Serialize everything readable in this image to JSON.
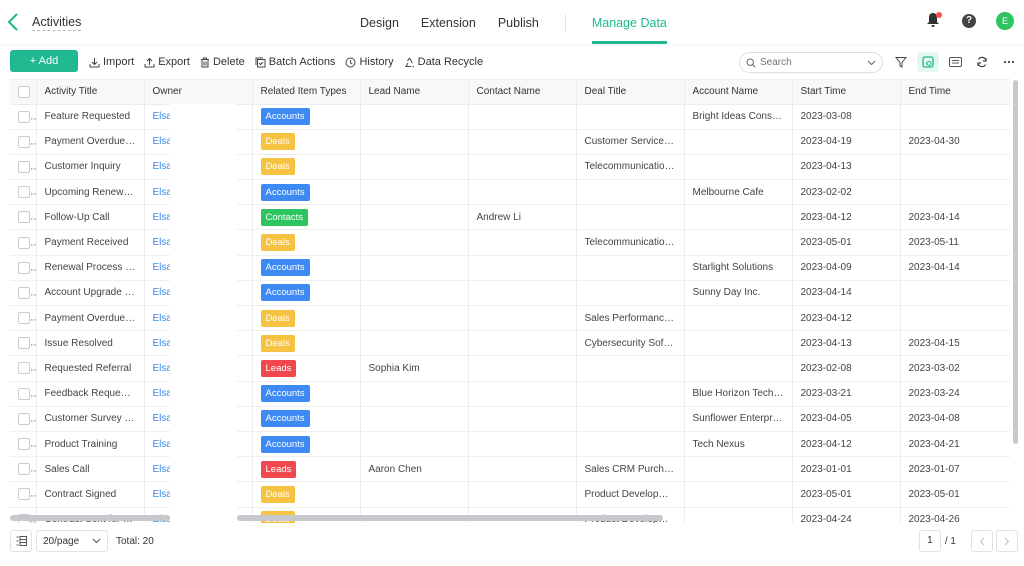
{
  "header": {
    "title": "Activities",
    "nav": [
      "Design",
      "Extension",
      "Publish",
      "Manage Data"
    ],
    "active_nav": "Manage Data",
    "avatar_letter": "E",
    "help_glyph": "?"
  },
  "toolbar": {
    "add_label": "+ Add",
    "actions": [
      {
        "label": "Import",
        "icon": "import-icon"
      },
      {
        "label": "Export",
        "icon": "export-icon"
      },
      {
        "label": "Delete",
        "icon": "trash-icon"
      },
      {
        "label": "Batch Actions",
        "icon": "batch-icon"
      },
      {
        "label": "History",
        "icon": "clock-icon"
      },
      {
        "label": "Data Recycle",
        "icon": "recycle-icon"
      }
    ],
    "search_placeholder": "Search"
  },
  "colors": {
    "accent": "#1fb891",
    "Accounts": "#3e8af5",
    "Deals": "#f5c242",
    "Contacts": "#2ec45f",
    "Leads": "#f0484e",
    "owner_link": "#3d8ae6"
  },
  "table": {
    "columns": [
      "Activity Title",
      "Owner",
      "Related Item Types",
      "Lead Name",
      "Contact Name",
      "Deal Title",
      "Account Name",
      "Start Time",
      "End Time"
    ],
    "rows": [
      {
        "title": "Feature Requested",
        "owner": "Elsa.",
        "type": "Accounts",
        "lead": "",
        "contact": "",
        "deal": "",
        "account": "Bright Ideas Consulti...",
        "start": "2023-03-08",
        "end": ""
      },
      {
        "title": "Payment Overdue R...",
        "owner": "Elsa.",
        "type": "Deals",
        "lead": "",
        "contact": "",
        "deal": "Customer Service So...",
        "account": "",
        "start": "2023-04-19",
        "end": "2023-04-30"
      },
      {
        "title": "Customer Inquiry",
        "owner": "Elsa.",
        "type": "Deals",
        "lead": "",
        "contact": "",
        "deal": "Telecommunications...",
        "account": "",
        "start": "2023-04-13",
        "end": ""
      },
      {
        "title": "Upcoming Renewal ...",
        "owner": "Elsa.",
        "type": "Accounts",
        "lead": "",
        "contact": "",
        "deal": "",
        "account": "Melbourne Cafe",
        "start": "2023-02-02",
        "end": ""
      },
      {
        "title": "Follow-Up Call",
        "owner": "Elsa.",
        "type": "Contacts",
        "lead": "",
        "contact": "Andrew Li",
        "deal": "",
        "account": "",
        "start": "2023-04-12",
        "end": "2023-04-14"
      },
      {
        "title": "Payment Received",
        "owner": "Elsa.",
        "type": "Deals",
        "lead": "",
        "contact": "",
        "deal": "Telecommunications...",
        "account": "",
        "start": "2023-05-01",
        "end": "2023-05-11"
      },
      {
        "title": "Renewal Process Sta...",
        "owner": "Elsa.",
        "type": "Accounts",
        "lead": "",
        "contact": "",
        "deal": "",
        "account": "Starlight Solutions",
        "start": "2023-04-09",
        "end": "2023-04-14"
      },
      {
        "title": "Account Upgrade Re...",
        "owner": "Elsa.",
        "type": "Accounts",
        "lead": "",
        "contact": "",
        "deal": "",
        "account": "Sunny Day Inc.",
        "start": "2023-04-14",
        "end": ""
      },
      {
        "title": "Payment Overdue R...",
        "owner": "Elsa.",
        "type": "Deals",
        "lead": "",
        "contact": "",
        "deal": "Sales Performance Tr...",
        "account": "",
        "start": "2023-04-12",
        "end": ""
      },
      {
        "title": "Issue Resolved",
        "owner": "Elsa.",
        "type": "Deals",
        "lead": "",
        "contact": "",
        "deal": "Cybersecurity Softw...",
        "account": "",
        "start": "2023-04-13",
        "end": "2023-04-15"
      },
      {
        "title": "Requested Referral",
        "owner": "Elsa.",
        "type": "Leads",
        "lead": "Sophia Kim",
        "contact": "",
        "deal": "",
        "account": "",
        "start": "2023-02-08",
        "end": "2023-03-02"
      },
      {
        "title": "Feedback Requested",
        "owner": "Elsa.",
        "type": "Accounts",
        "lead": "",
        "contact": "",
        "deal": "",
        "account": "Blue Horizon Techno...",
        "start": "2023-03-21",
        "end": "2023-03-24"
      },
      {
        "title": "Customer Survey Sent",
        "owner": "Elsa.",
        "type": "Accounts",
        "lead": "",
        "contact": "",
        "deal": "",
        "account": "Sunflower Enterprises",
        "start": "2023-04-05",
        "end": "2023-04-08"
      },
      {
        "title": "Product Training",
        "owner": "Elsa.",
        "type": "Accounts",
        "lead": "",
        "contact": "",
        "deal": "",
        "account": "Tech Nexus",
        "start": "2023-04-12",
        "end": "2023-04-21"
      },
      {
        "title": "Sales Call",
        "owner": "Elsa.",
        "type": "Leads",
        "lead": "Aaron Chen",
        "contact": "",
        "deal": "Sales CRM Purchase",
        "account": "",
        "start": "2023-01-01",
        "end": "2023-01-07"
      },
      {
        "title": "Contract Signed",
        "owner": "Elsa.",
        "type": "Deals",
        "lead": "",
        "contact": "",
        "deal": "Product Developme...",
        "account": "",
        "start": "2023-05-01",
        "end": "2023-05-01"
      },
      {
        "title": "Contract Sent for Sig...",
        "owner": "Elsa.",
        "type": "Deals",
        "lead": "",
        "contact": "",
        "deal": "Product Developme...",
        "account": "",
        "start": "2023-04-24",
        "end": "2023-04-26"
      }
    ]
  },
  "footer": {
    "page_size": "20/page",
    "total": "Total: 20",
    "current_page": "1",
    "page_of": "/ 1"
  }
}
